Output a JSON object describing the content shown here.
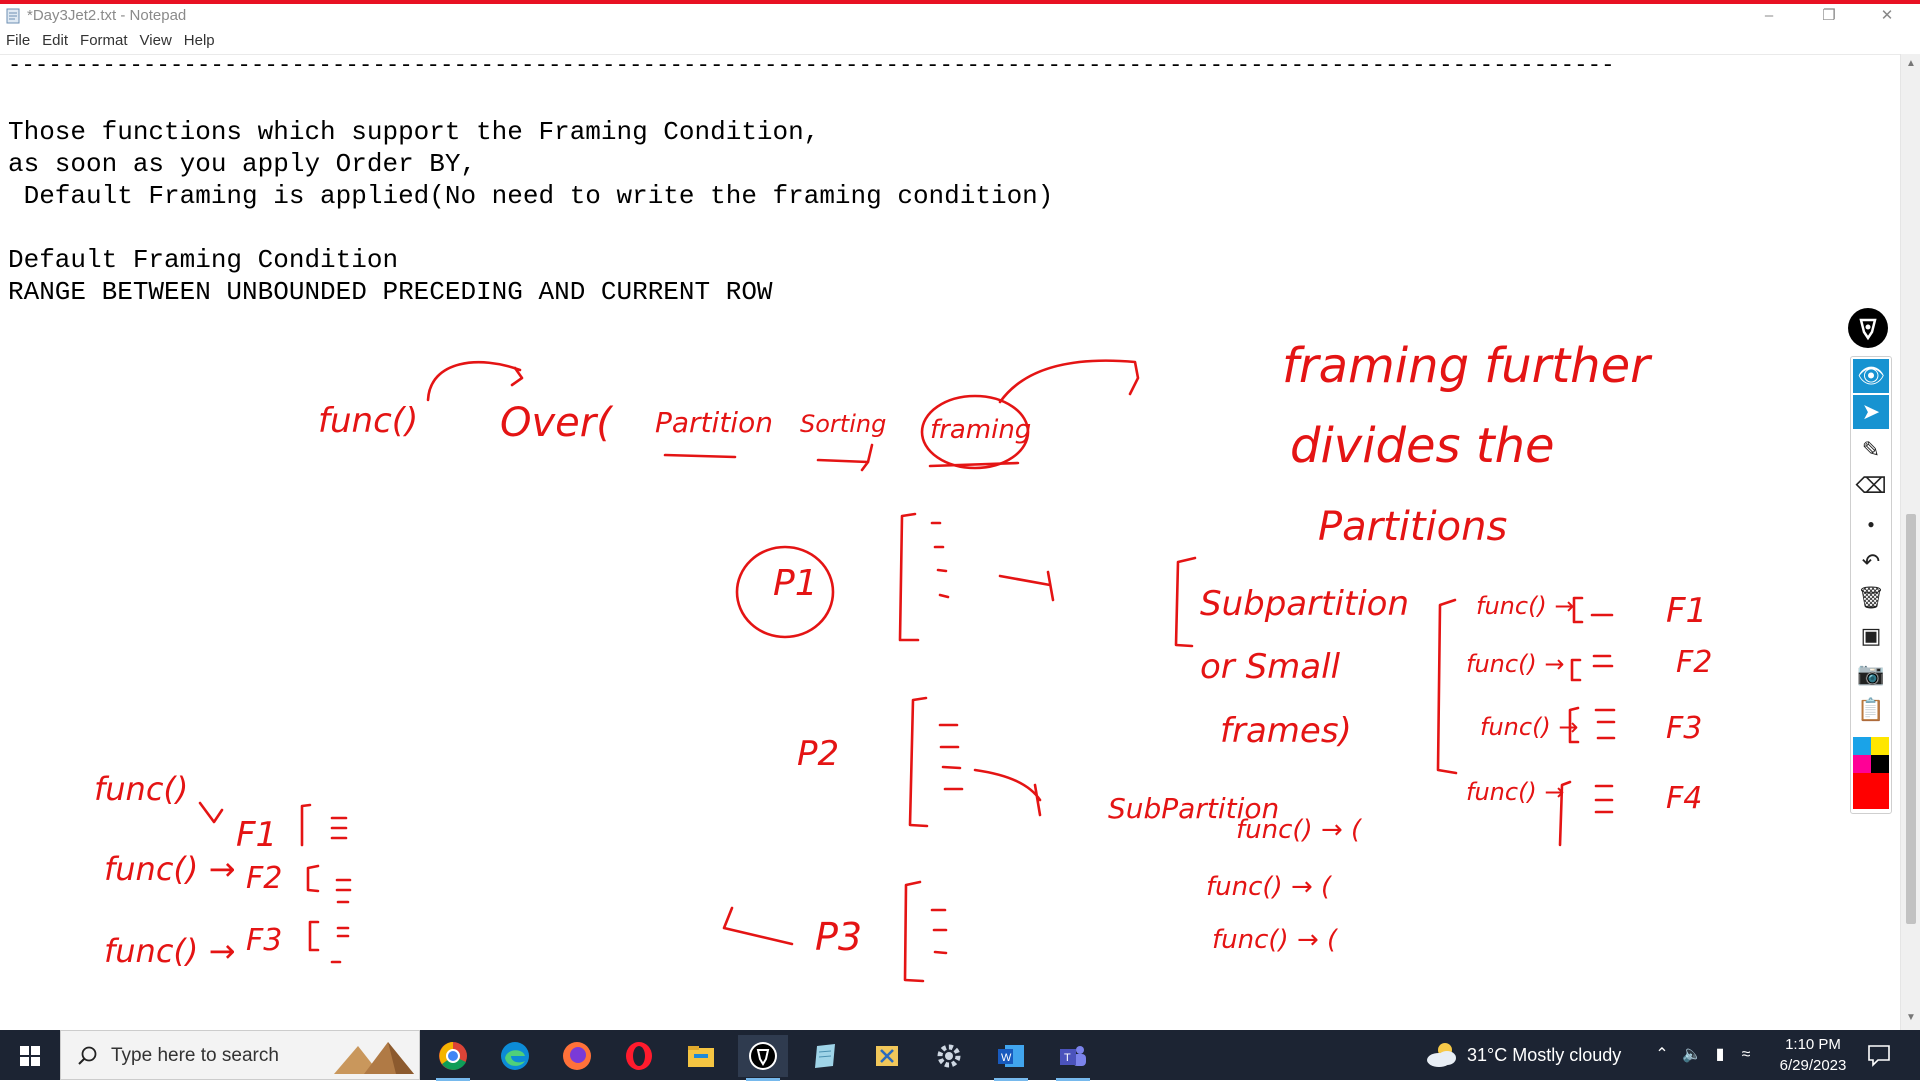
{
  "window": {
    "title": "*Day3Jet2.txt - Notepad",
    "controls": {
      "minimize": "–",
      "restore": "❐",
      "close": "✕"
    }
  },
  "menu": [
    "File",
    "Edit",
    "Format",
    "View",
    "Help"
  ],
  "editor": {
    "lines": [
      "-----------------------------------------------------------------------------------------------------------------------",
      "",
      "Those functions which support the Framing Condition,",
      "as soon as you apply Order BY,",
      " Default Framing is applied(No need to write the framing condition)",
      "",
      "Default Framing Condition",
      "RANGE BETWEEN UNBOUNDED PRECEDING AND CURRENT ROW"
    ]
  },
  "annotations": {
    "syntax": [
      "func()",
      "Over(",
      "Partition",
      "Sorting",
      "framing"
    ],
    "note": [
      "framing further",
      "divides the",
      "Partitions"
    ],
    "partitions": [
      "P1",
      "P2",
      "P3"
    ],
    "subpartition_note": [
      "Subpartition",
      "or Small",
      "frames)"
    ],
    "subpartition_label": "SubPartition",
    "func_list_right": [
      "func() →",
      "func() →",
      "func() →",
      "func() →"
    ],
    "frame_labels_right": [
      "F1",
      "F2",
      "F3",
      "F4"
    ],
    "func_list_left": [
      "func()",
      "func() →",
      "func() →"
    ],
    "frame_labels_left": [
      "F1",
      "F2",
      "F3"
    ],
    "subpart_funcs": [
      "func() → (",
      "func() → (",
      "func() → ("
    ]
  },
  "pen_tools": [
    "eye-icon",
    "cursor-icon",
    "pen-icon",
    "eraser-icon",
    "dot-icon",
    "undo-icon",
    "trash-icon",
    "whiteboard-icon",
    "camera-icon",
    "clipboard-icon"
  ],
  "palette": [
    "#1aa3e8",
    "#ffe600",
    "#ff0096",
    "#000000",
    "#ff0000"
  ],
  "taskbar": {
    "search_placeholder": "Type here to search",
    "apps": [
      "chrome-icon",
      "edge-icon",
      "firefox-icon",
      "opera-icon",
      "file-explorer-icon",
      "epicpen-icon",
      "notepad-icon",
      "snip-icon",
      "settings-icon",
      "word-icon",
      "teams-icon"
    ],
    "weather": "31°C  Mostly cloudy",
    "time": "1:10 PM",
    "date": "6/29/2023"
  }
}
